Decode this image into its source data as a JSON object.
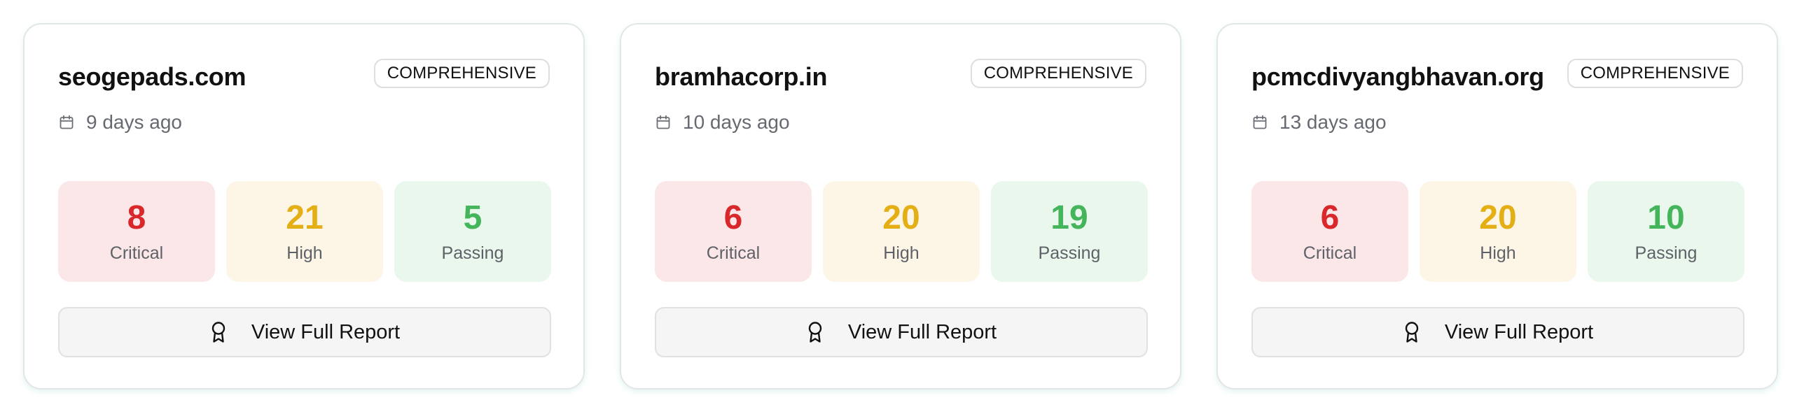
{
  "cards": [
    {
      "domain": "seogepads.com",
      "badge": "COMPREHENSIVE",
      "date": "9 days ago",
      "date_icon": "calendar-icon",
      "stats": {
        "critical": {
          "value": "8",
          "label": "Critical"
        },
        "high": {
          "value": "21",
          "label": "High"
        },
        "passing": {
          "value": "5",
          "label": "Passing"
        }
      },
      "button": {
        "label": "View Full Report",
        "icon": "award-icon"
      }
    },
    {
      "domain": "bramhacorp.in",
      "badge": "COMPREHENSIVE",
      "date": "10 days ago",
      "date_icon": "calendar-icon",
      "stats": {
        "critical": {
          "value": "6",
          "label": "Critical"
        },
        "high": {
          "value": "20",
          "label": "High"
        },
        "passing": {
          "value": "19",
          "label": "Passing"
        }
      },
      "button": {
        "label": "View Full Report",
        "icon": "award-icon"
      }
    },
    {
      "domain": "pcmcdivyangbhavan.org",
      "badge": "COMPREHENSIVE",
      "date": "13 days ago",
      "date_icon": "calendar-icon",
      "stats": {
        "critical": {
          "value": "6",
          "label": "Critical"
        },
        "high": {
          "value": "20",
          "label": "High"
        },
        "passing": {
          "value": "10",
          "label": "Passing"
        }
      },
      "button": {
        "label": "View Full Report",
        "icon": "award-icon"
      }
    }
  ],
  "colors": {
    "critical": "#d8282b",
    "critical_bg": "#fbe7e7",
    "high": "#e4ae15",
    "high_bg": "#fdf6e6",
    "passing": "#44b55a",
    "passing_bg": "#e9f7ec"
  }
}
